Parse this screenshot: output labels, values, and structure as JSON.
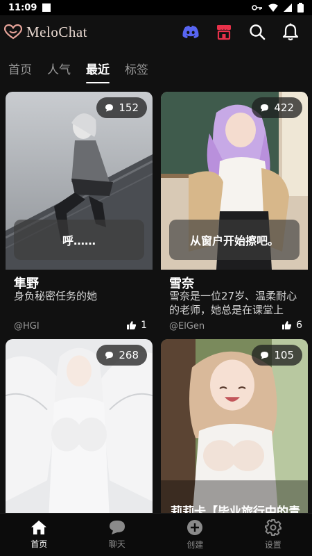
{
  "status": {
    "time": "11:09"
  },
  "app": {
    "name": "MeloChat"
  },
  "tabs": [
    "首页",
    "人气",
    "最近",
    "标签"
  ],
  "active_tab": "最近",
  "cards": [
    {
      "count": "152",
      "bubble": "呼……",
      "title": "隼野",
      "desc": "身负秘密任务的她",
      "author": "@HGI",
      "likes": "1"
    },
    {
      "count": "422",
      "bubble": "从窗户开始擦吧。",
      "title": "雪奈",
      "desc": "雪奈是一位27岁、温柔耐心的老师，她总是在课堂上",
      "author": "@ElGen",
      "likes": "6"
    },
    {
      "count": "268"
    },
    {
      "count": "105",
      "title": "莉莉卡【毕业旅行中的青"
    }
  ],
  "nav": {
    "home": "首页",
    "chat": "聊天",
    "create": "创建",
    "settings": "设置"
  },
  "colors": {
    "discord": "#5865F2",
    "store": "#e8314a",
    "background": "#111111"
  }
}
